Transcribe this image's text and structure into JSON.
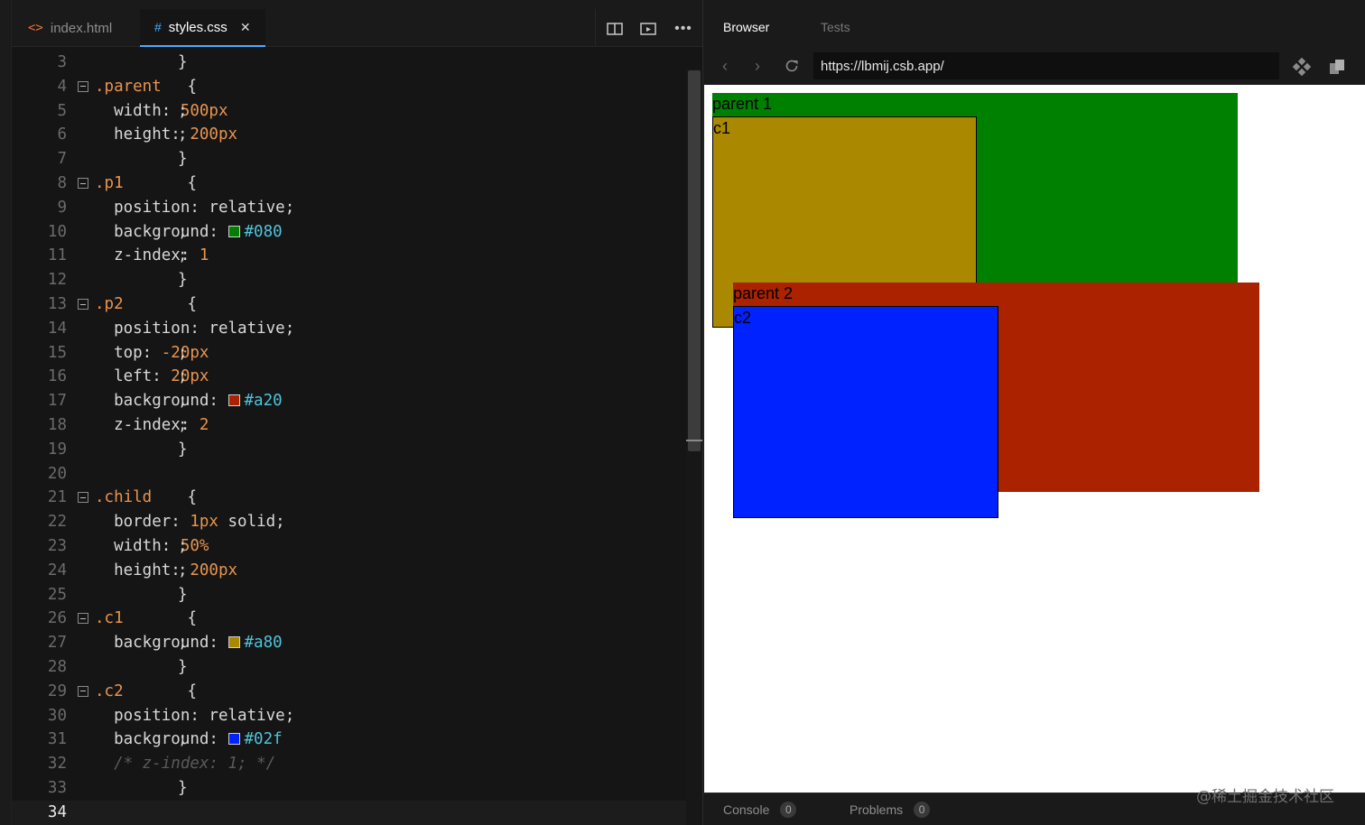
{
  "editor": {
    "tabs": [
      {
        "icon": "html-file-icon",
        "label": "index.html"
      },
      {
        "icon": "css-file-icon",
        "label": "styles.css",
        "active": true
      }
    ],
    "code_lines": [
      {
        "n": "3",
        "tokens": [
          [
            "txt",
            "}"
          ]
        ]
      },
      {
        "n": "4",
        "fold": true,
        "tokens": [
          [
            "sel",
            ".parent"
          ],
          [
            "txt",
            " {"
          ]
        ]
      },
      {
        "n": "5",
        "tokens": [
          [
            "prop",
            "  width: "
          ],
          [
            "num",
            "500px"
          ],
          [
            "txt",
            ";"
          ]
        ]
      },
      {
        "n": "6",
        "tokens": [
          [
            "prop",
            "  height: "
          ],
          [
            "num",
            "200px"
          ],
          [
            "txt",
            ";"
          ]
        ]
      },
      {
        "n": "7",
        "tokens": [
          [
            "txt",
            "}"
          ]
        ]
      },
      {
        "n": "8",
        "fold": true,
        "tokens": [
          [
            "sel",
            ".p1"
          ],
          [
            "txt",
            " {"
          ]
        ]
      },
      {
        "n": "9",
        "tokens": [
          [
            "prop",
            "  position: relative;"
          ]
        ]
      },
      {
        "n": "10",
        "tokens": [
          [
            "prop",
            "  background: "
          ],
          [
            "swatch",
            "#008000"
          ],
          [
            "hex",
            "#080"
          ],
          [
            "txt",
            ";"
          ]
        ]
      },
      {
        "n": "11",
        "tokens": [
          [
            "prop",
            "  z-index: "
          ],
          [
            "num",
            "1"
          ],
          [
            "txt",
            ";"
          ]
        ]
      },
      {
        "n": "12",
        "tokens": [
          [
            "txt",
            "}"
          ]
        ]
      },
      {
        "n": "13",
        "fold": true,
        "tokens": [
          [
            "sel",
            ".p2"
          ],
          [
            "txt",
            " {"
          ]
        ]
      },
      {
        "n": "14",
        "tokens": [
          [
            "prop",
            "  position: relative;"
          ]
        ]
      },
      {
        "n": "15",
        "tokens": [
          [
            "prop",
            "  top: "
          ],
          [
            "num",
            "-20px"
          ],
          [
            "txt",
            ";"
          ]
        ]
      },
      {
        "n": "16",
        "tokens": [
          [
            "prop",
            "  left: "
          ],
          [
            "num",
            "20px"
          ],
          [
            "txt",
            ";"
          ]
        ]
      },
      {
        "n": "17",
        "tokens": [
          [
            "prop",
            "  background: "
          ],
          [
            "swatch",
            "#aa2200"
          ],
          [
            "hex",
            "#a20"
          ],
          [
            "txt",
            ";"
          ]
        ]
      },
      {
        "n": "18",
        "tokens": [
          [
            "prop",
            "  z-index: "
          ],
          [
            "num",
            "2"
          ],
          [
            "txt",
            ";"
          ]
        ]
      },
      {
        "n": "19",
        "tokens": [
          [
            "txt",
            "}"
          ]
        ]
      },
      {
        "n": "20",
        "tokens": []
      },
      {
        "n": "21",
        "fold": true,
        "tokens": [
          [
            "sel",
            ".child"
          ],
          [
            "txt",
            " {"
          ]
        ]
      },
      {
        "n": "22",
        "tokens": [
          [
            "prop",
            "  border: "
          ],
          [
            "num",
            "1px"
          ],
          [
            "prop",
            " solid;"
          ]
        ]
      },
      {
        "n": "23",
        "tokens": [
          [
            "prop",
            "  width: "
          ],
          [
            "num",
            "50%"
          ],
          [
            "txt",
            ";"
          ]
        ]
      },
      {
        "n": "24",
        "tokens": [
          [
            "prop",
            "  height: "
          ],
          [
            "num",
            "200px"
          ],
          [
            "txt",
            ";"
          ]
        ]
      },
      {
        "n": "25",
        "tokens": [
          [
            "txt",
            "}"
          ]
        ]
      },
      {
        "n": "26",
        "fold": true,
        "tokens": [
          [
            "sel",
            ".c1"
          ],
          [
            "txt",
            " {"
          ]
        ]
      },
      {
        "n": "27",
        "tokens": [
          [
            "prop",
            "  background: "
          ],
          [
            "swatch",
            "#aa8800"
          ],
          [
            "hex",
            "#a80"
          ],
          [
            "txt",
            ";"
          ]
        ]
      },
      {
        "n": "28",
        "tokens": [
          [
            "txt",
            "}"
          ]
        ]
      },
      {
        "n": "29",
        "fold": true,
        "tokens": [
          [
            "sel",
            ".c2"
          ],
          [
            "txt",
            " {"
          ]
        ]
      },
      {
        "n": "30",
        "tokens": [
          [
            "prop",
            "  position: relative;"
          ]
        ]
      },
      {
        "n": "31",
        "tokens": [
          [
            "prop",
            "  background: "
          ],
          [
            "swatch",
            "#0022ff"
          ],
          [
            "hex",
            "#02f"
          ],
          [
            "txt",
            ";"
          ]
        ]
      },
      {
        "n": "32",
        "tokens": [
          [
            "cmt",
            "  /* z-index: 1; */"
          ]
        ]
      },
      {
        "n": "33",
        "tokens": [
          [
            "txt",
            "}"
          ]
        ]
      },
      {
        "n": "34",
        "current": true,
        "tokens": []
      }
    ]
  },
  "preview": {
    "tabs": [
      "Browser",
      "Tests"
    ],
    "url": "https://lbmij.csb.app/",
    "boxes": {
      "parent1": {
        "label": "parent 1",
        "color": "#008000"
      },
      "c1": {
        "label": "c1",
        "color": "#aa8800"
      },
      "parent2": {
        "label": "parent 2",
        "color": "#aa2200"
      },
      "c2": {
        "label": "c2",
        "color": "#0022ff"
      }
    },
    "console": {
      "label": "Console",
      "count": "0"
    },
    "problems": {
      "label": "Problems",
      "count": "0"
    },
    "watermark": "@稀土掘金技术社区"
  }
}
